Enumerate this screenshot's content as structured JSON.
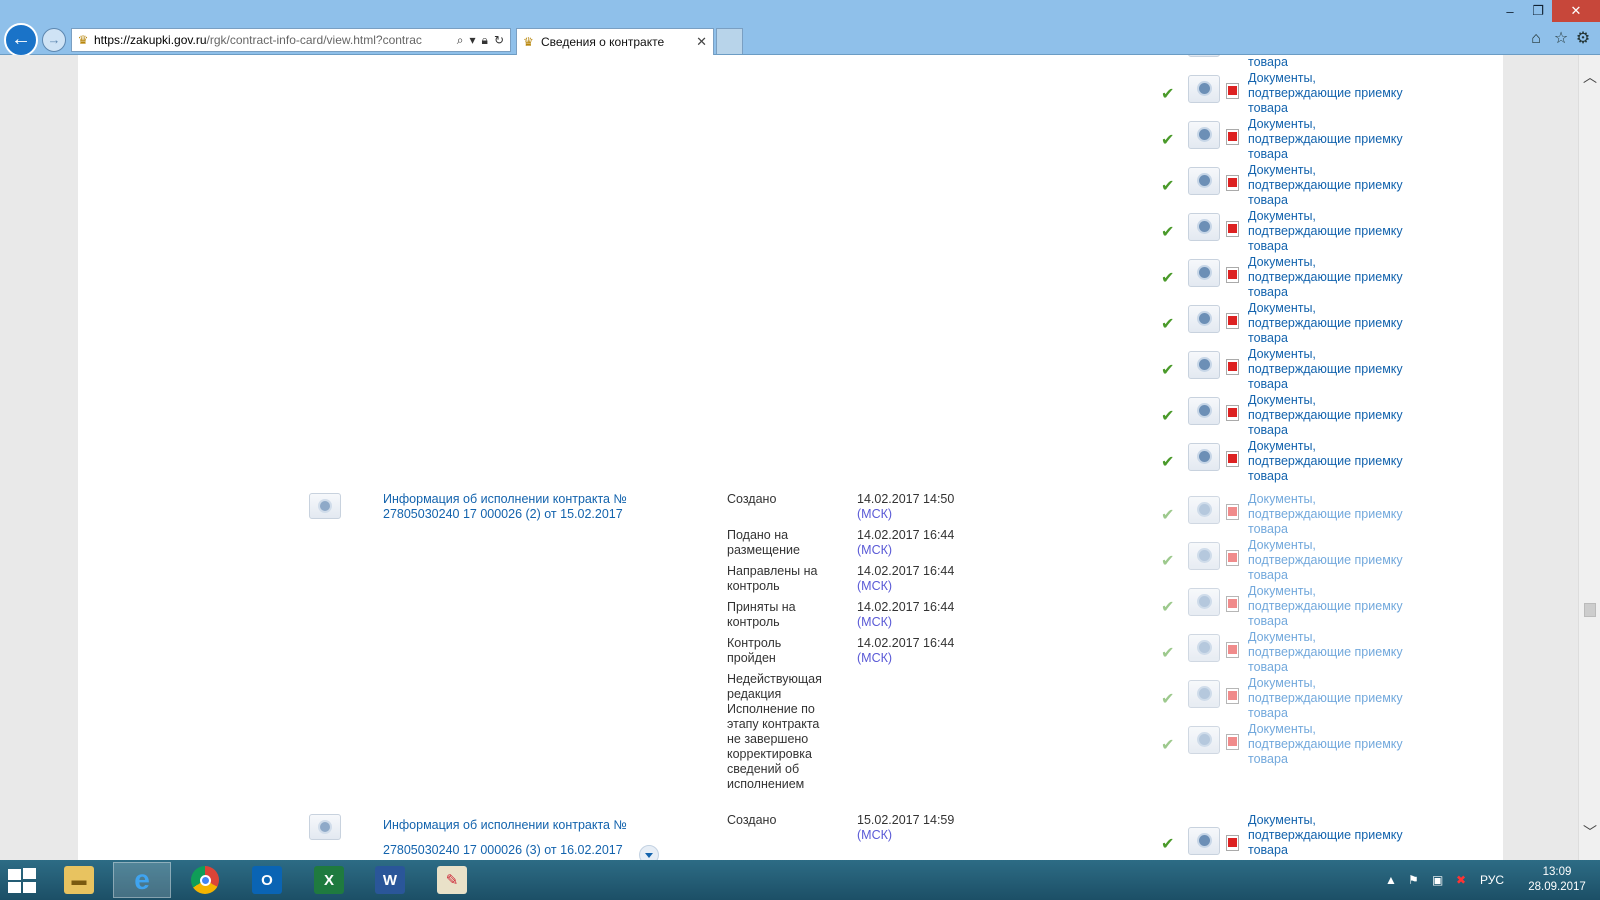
{
  "window": {
    "minimize": "–",
    "maximize": "❐",
    "close": "✕"
  },
  "address": {
    "url_host": "https://zakupki.gov.ru",
    "url_path": "/rgk/contract-info-card/view.html?contrac"
  },
  "tab": {
    "title": "Сведения о контракте"
  },
  "doc_label": {
    "line1": "Документы,",
    "line2": "подтверждающие приемку",
    "line3": "товара"
  },
  "entries": [
    {
      "title_line1": "Информация об исполнении контракта №",
      "title_line2": "27805030240 17 000026 (2) от 15.02.2017",
      "events": [
        {
          "status_line1": "Создано",
          "status_line2": "",
          "date": "14.02.2017 14:50",
          "tz": "(МСК)"
        },
        {
          "status_line1": "Подано на",
          "status_line2": "размещение",
          "date": "14.02.2017 16:44",
          "tz": "(МСК)"
        },
        {
          "status_line1": "Направлены на",
          "status_line2": "контроль",
          "date": "14.02.2017 16:44",
          "tz": "(МСК)"
        },
        {
          "status_line1": "Приняты на",
          "status_line2": "контроль",
          "date": "14.02.2017 16:44",
          "tz": "(МСК)"
        },
        {
          "status_line1": "Контроль",
          "status_line2": "пройден",
          "date": "14.02.2017 16:44",
          "tz": "(МСК)"
        }
      ],
      "note": [
        "Недействующая",
        "редакция",
        "Исполнение по",
        "этапу контракта",
        "не завершено",
        "корректировка",
        "сведений об",
        "исполнением"
      ]
    },
    {
      "title_line1": "Информация об исполнении контракта №",
      "title_line2": "27805030240 17 000026 (3) от 16.02.2017",
      "events": [
        {
          "status_line1": "Создано",
          "status_line2": "",
          "date": "15.02.2017 14:59",
          "tz": "(МСК)"
        }
      ]
    }
  ],
  "taskbar": {
    "lang": "РУС",
    "time": "13:09",
    "date": "28.09.2017"
  }
}
